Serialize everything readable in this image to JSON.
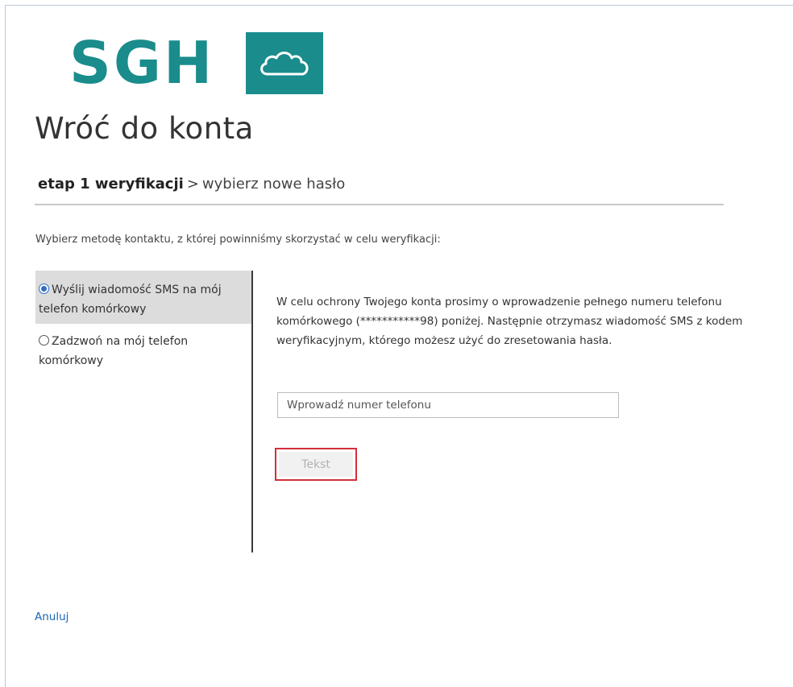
{
  "brand": {
    "logo_text": "SGH",
    "color": "#1a8c8c"
  },
  "page": {
    "title": "Wróć do konta"
  },
  "breadcrumb": {
    "current_step": "etap 1 weryfikacji",
    "separator": ">",
    "next_step": "wybierz nowe hasło"
  },
  "instruction": "Wybierz metodę kontaktu, z której powinniśmy skorzystać w celu weryfikacji:",
  "methods": {
    "items": [
      {
        "label": "Wyślij wiadomość SMS na mój telefon komórkowy",
        "selected": true
      },
      {
        "label": "Zadzwoń na mój telefon komórkowy",
        "selected": false
      }
    ]
  },
  "main": {
    "description": "W celu ochrony Twojego konta prosimy o wprowadzenie pełnego numeru telefonu komórkowego (***********98) poniżej. Następnie otrzymasz wiadomość SMS z kodem weryfikacyjnym, którego możesz użyć do zresetowania hasła.",
    "phone_placeholder": "Wprowadź numer telefonu",
    "submit_label": "Tekst",
    "highlight_color": "#d32f3a"
  },
  "footer": {
    "cancel_label": "Anuluj",
    "link_color": "#1a66b5"
  }
}
